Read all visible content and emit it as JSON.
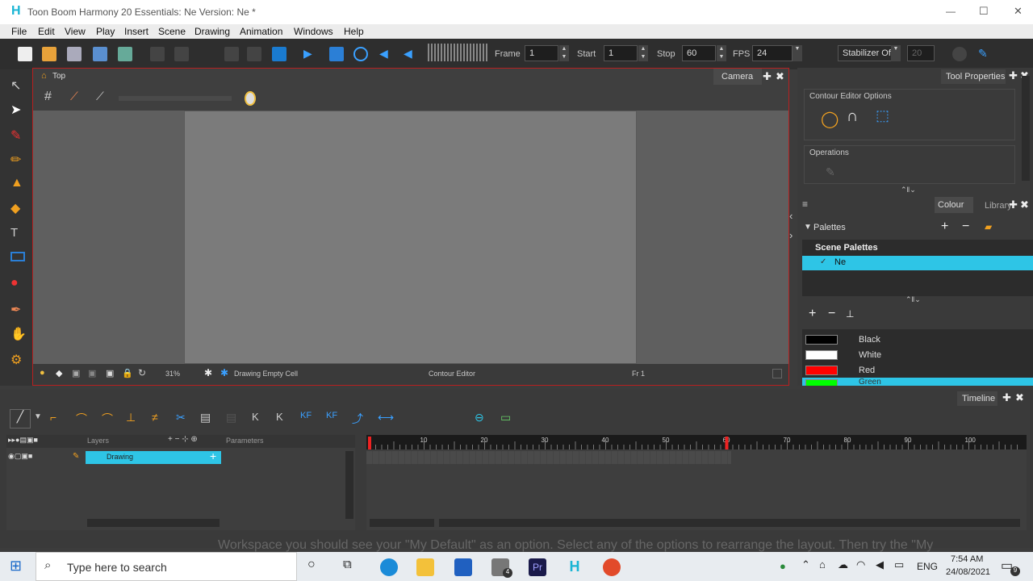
{
  "window": {
    "app_icon": "H",
    "title": "Toon Boom Harmony 20 Essentials: Ne Version: Ne *",
    "minimize": "—",
    "maximize": "☐",
    "close": "✕"
  },
  "menu": [
    "File",
    "Edit",
    "View",
    "Play",
    "Insert",
    "Scene",
    "Drawing",
    "Animation",
    "Windows",
    "Help"
  ],
  "toolbar": {
    "frame_label": "Frame",
    "frame_value": "1",
    "start_label": "Start",
    "start_value": "1",
    "stop_label": "Stop",
    "stop_value": "60",
    "fps_label": "FPS",
    "fps_value": "24",
    "stabilizer": "Stabilizer Off",
    "stabilizer_value": "20"
  },
  "viewport": {
    "breadcrumb": "Top",
    "camera_tab": "Camera",
    "zoom": "31%",
    "drawing_status": "Drawing Empty Cell",
    "tool_status": "Contour Editor",
    "frame_status": "Fr 1"
  },
  "tool_properties": {
    "tab": "Tool Properties",
    "section": "Contour Editor Options",
    "operations": "Operations"
  },
  "colour_panel": {
    "tab_colour": "Colour",
    "tab_library": "Library",
    "palettes_label": "Palettes",
    "scene_palettes": "Scene Palettes",
    "palette_selected": "Ne",
    "colors": [
      {
        "name": "Black",
        "hex": "#000000"
      },
      {
        "name": "White",
        "hex": "#ffffff"
      },
      {
        "name": "Red",
        "hex": "#ff0000"
      },
      {
        "name": "Green",
        "hex": "#00ff00"
      }
    ]
  },
  "timeline": {
    "tab": "Timeline",
    "layers_header": "Layers",
    "parameters_header": "Parameters",
    "layer_name": "Drawing",
    "ruler_marks": [
      "10",
      "20",
      "30",
      "40",
      "50",
      "60",
      "70",
      "80",
      "90",
      "100"
    ],
    "playhead": 1,
    "stop_marker": 60
  },
  "overlay_text": "Workspace you should see your \"My Default\" as an option. Select any of the options to rearrange the layout. Then try the \"My",
  "taskbar": {
    "search_placeholder": "Type here to search",
    "language": "ENG",
    "time": "7:54 AM",
    "date": "24/08/2021",
    "notification_count": "9",
    "mail_badge": "4"
  },
  "colors": {
    "accent": "#19b5d4",
    "selection": "#2ec5e6",
    "border_red": "#b72020"
  }
}
